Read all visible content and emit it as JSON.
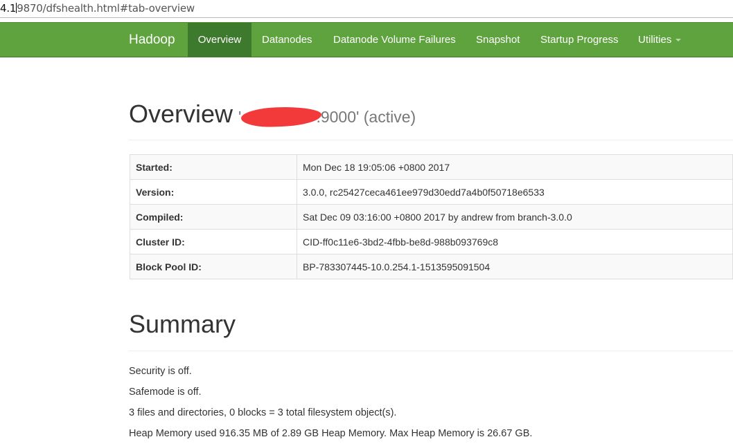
{
  "address_bar": {
    "host_fragment": "4.1",
    "path": "9870/dfshealth.html#tab-overview"
  },
  "navbar": {
    "brand": "Hadoop",
    "items": [
      {
        "label": "Overview",
        "active": true
      },
      {
        "label": "Datanodes"
      },
      {
        "label": "Datanode Volume Failures"
      },
      {
        "label": "Snapshot"
      },
      {
        "label": "Startup Progress"
      },
      {
        "label": "Utilities",
        "has_dropdown": true
      }
    ],
    "colors": {
      "background": "#5fa33e",
      "active": "#3e7a2d"
    }
  },
  "overview": {
    "title": "Overview",
    "subtitle_prefix": "'",
    "subtitle_suffix": ":9000' (active)",
    "rows": [
      {
        "key": "Started:",
        "value": "Mon Dec 18 19:05:06 +0800 2017"
      },
      {
        "key": "Version:",
        "value": "3.0.0, rc25427ceca461ee979d30edd7a4b0f50718e6533"
      },
      {
        "key": "Compiled:",
        "value": "Sat Dec 09 03:16:00 +0800 2017 by andrew from branch-3.0.0"
      },
      {
        "key": "Cluster ID:",
        "value": "CID-ff0c11e6-3bd2-4fbb-be8d-988b093769c8"
      },
      {
        "key": "Block Pool ID:",
        "value": "BP-783307445-10.0.254.1-1513595091504"
      }
    ]
  },
  "summary": {
    "title": "Summary",
    "lines": [
      "Security is off.",
      "Safemode is off.",
      "3 files and directories, 0 blocks = 3 total filesystem object(s).",
      "Heap Memory used 916.35 MB of 2.89 GB Heap Memory. Max Heap Memory is 26.67 GB."
    ]
  }
}
